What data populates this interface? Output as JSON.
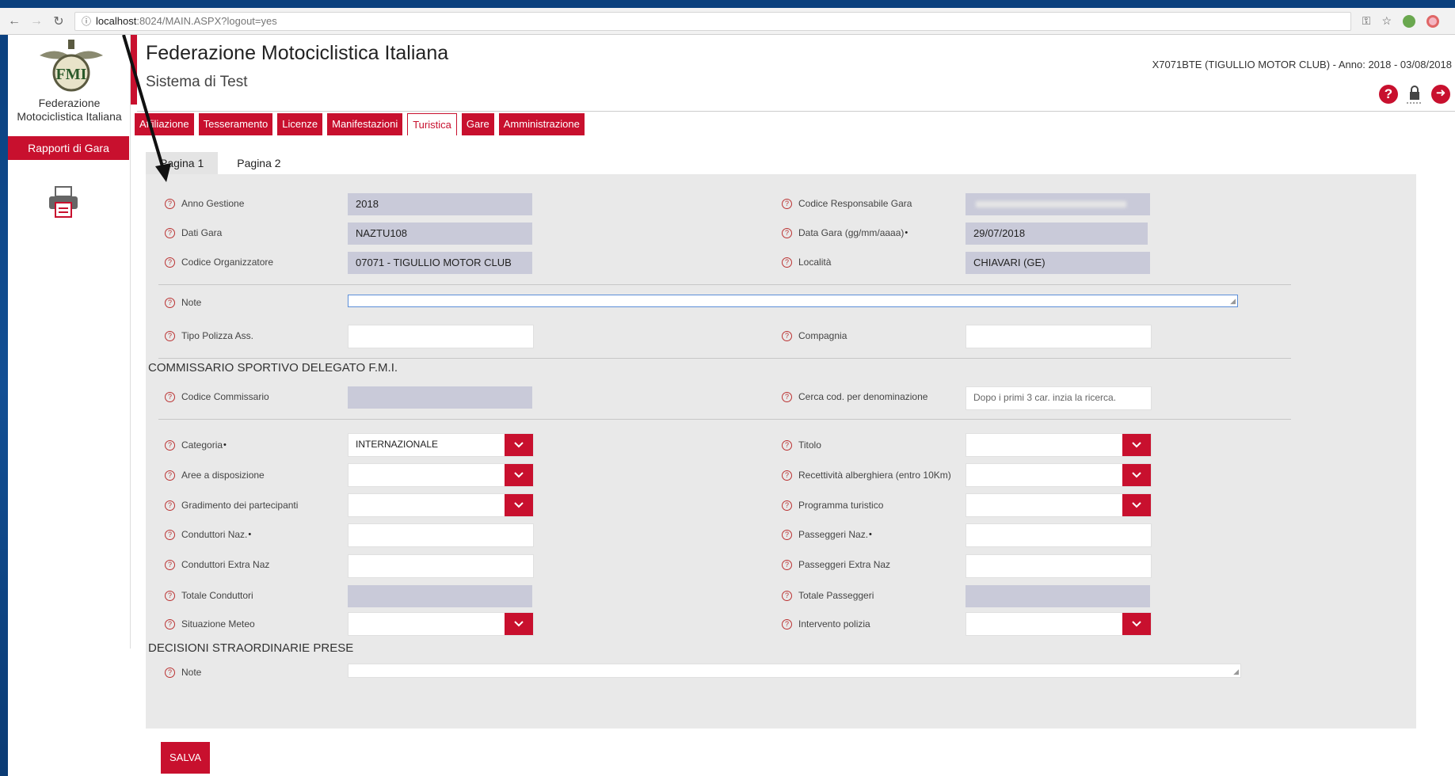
{
  "browser": {
    "url_host": "localhost",
    "url_path": ":8024/MAIN.ASPX?logout=yes"
  },
  "sidebar": {
    "logo_text": "Federazione Motociclistica Italiana",
    "menu_item": "Rapporti di Gara"
  },
  "header": {
    "title": "Federazione Motociclistica Italiana",
    "subtitle": "Sistema di Test",
    "user_info": "X7071BTE (TIGULLIO MOTOR CLUB) - Anno: 2018 - 03/08/2018"
  },
  "nav": {
    "tabs": [
      "Affiliazione",
      "Tesseramento",
      "Licenze",
      "Manifestazioni",
      "Turistica",
      "Gare",
      "Amministrazione"
    ],
    "active": "Turistica"
  },
  "page_tabs": [
    "Pagina 1",
    "Pagina 2"
  ],
  "form": {
    "anno_gestione_label": "Anno Gestione",
    "anno_gestione_value": "2018",
    "dati_gara_label": "Dati Gara",
    "dati_gara_value": "NAZTU108",
    "codice_org_label": "Codice Organizzatore",
    "codice_org_value": "07071 - TIGULLIO MOTOR CLUB",
    "codice_resp_label": "Codice Responsabile Gara",
    "data_gara_label": "Data Gara (gg/mm/aaaa)",
    "data_gara_value": "29/07/2018",
    "localita_label": "Località",
    "localita_value": "CHIAVARI (GE)",
    "note_label": "Note",
    "tipo_polizza_label": "Tipo Polizza Ass.",
    "compagnia_label": "Compagnia",
    "section_commissario": "COMMISSARIO SPORTIVO DELEGATO F.M.I.",
    "codice_commissario_label": "Codice Commissario",
    "cerca_label": "Cerca cod. per denominazione",
    "cerca_placeholder": "Dopo i primi 3 car. inzia la ricerca.",
    "categoria_label": "Categoria",
    "categoria_value": "INTERNAZIONALE",
    "titolo_label": "Titolo",
    "aree_label": "Aree a disposizione",
    "recettivita_label": "Recettività alberghiera (entro 10Km)",
    "gradimento_label": "Gradimento dei partecipanti",
    "programma_label": "Programma turistico",
    "conduttori_naz_label": "Conduttori Naz.",
    "passeggeri_naz_label": "Passeggeri Naz.",
    "conduttori_extra_label": "Conduttori Extra Naz",
    "passeggeri_extra_label": "Passeggeri Extra Naz",
    "totale_conduttori_label": "Totale Conduttori",
    "totale_passeggeri_label": "Totale Passeggeri",
    "meteo_label": "Situazione Meteo",
    "polizia_label": "Intervento polizia",
    "section_decisioni": "DECISIONI STRAORDINARIE PRESE",
    "note2_label": "Note",
    "required_mark": "•",
    "help_glyph": "?"
  },
  "save_label": "SALVA",
  "colors": {
    "accent": "#c8102e",
    "readonly": "#c9cad9",
    "panel": "#e9e9e9"
  }
}
